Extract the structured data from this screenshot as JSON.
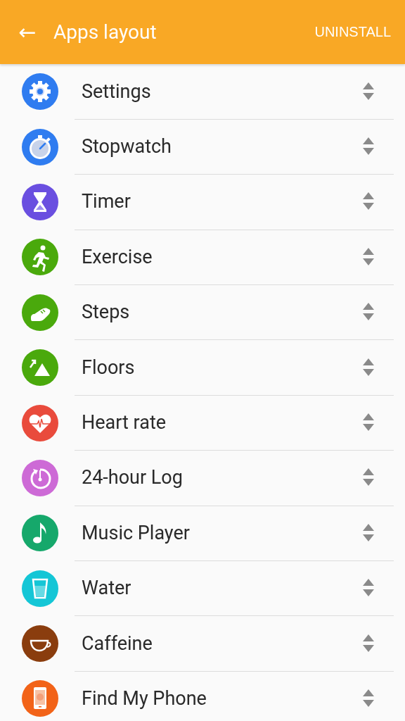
{
  "header": {
    "back": "←",
    "title": "Apps layout",
    "action": "UNINSTALL"
  },
  "apps": [
    {
      "name": "Settings",
      "color": "#2f7cf0"
    },
    {
      "name": "Stopwatch",
      "color": "#2f7cf0"
    },
    {
      "name": "Timer",
      "color": "#6a4fe0"
    },
    {
      "name": "Exercise",
      "color": "#4aa90c"
    },
    {
      "name": "Steps",
      "color": "#4aa90c"
    },
    {
      "name": "Floors",
      "color": "#4aa90c"
    },
    {
      "name": "Heart rate",
      "color": "#e94b3c"
    },
    {
      "name": "24-hour Log",
      "color": "#cd6ad6"
    },
    {
      "name": "Music Player",
      "color": "#16a86b"
    },
    {
      "name": "Water",
      "color": "#14c6d6"
    },
    {
      "name": "Caffeine",
      "color": "#8a3d0e"
    },
    {
      "name": "Find My Phone",
      "color": "#f26318"
    }
  ]
}
